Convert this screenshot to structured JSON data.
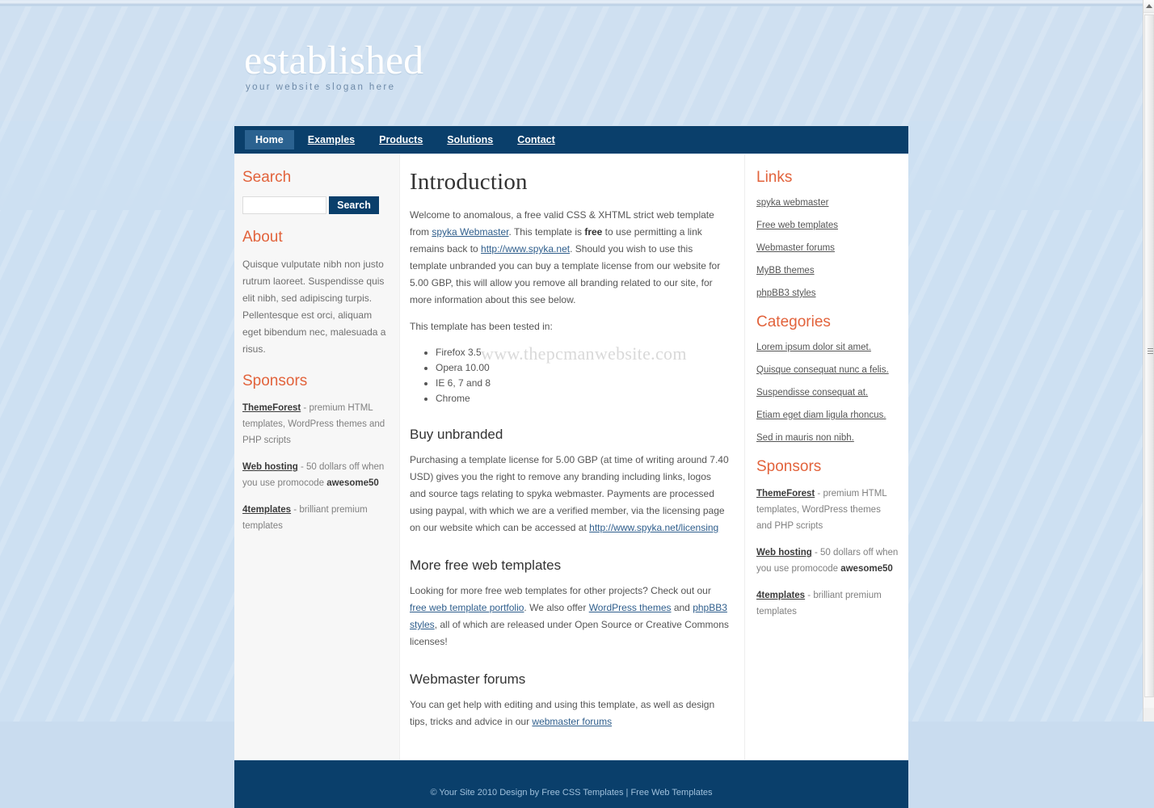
{
  "header": {
    "logo": "established",
    "slogan": "your website slogan here"
  },
  "nav": {
    "items": [
      {
        "label": "Home",
        "active": true
      },
      {
        "label": "Examples",
        "active": false
      },
      {
        "label": "Products",
        "active": false
      },
      {
        "label": "Solutions",
        "active": false
      },
      {
        "label": "Contact",
        "active": false
      }
    ]
  },
  "sidebar_left": {
    "search": {
      "heading": "Search",
      "value": "",
      "placeholder": "",
      "button_label": "Search"
    },
    "about": {
      "heading": "About",
      "text": "Quisque vulputate nibh non justo rutrum laoreet. Suspendisse quis elit nibh, sed adipiscing turpis. Pellentesque est orci, aliquam eget bibendum nec, malesuada a risus."
    },
    "sponsors": {
      "heading": "Sponsors",
      "items": [
        {
          "link": "ThemeForest",
          "text": " - premium HTML templates, WordPress themes and PHP scripts"
        },
        {
          "link": "Web hosting",
          "text": " - 50 dollars off when you use promocode ",
          "promo": "awesome50"
        },
        {
          "link": "4templates",
          "text": " - brilliant premium templates"
        }
      ]
    }
  },
  "main": {
    "title": "Introduction",
    "intro_1a": "Welcome to anomalous, a free valid CSS & XHTML strict web template from ",
    "intro_link_1": "spyka Webmaster",
    "intro_1b": ". This template is ",
    "intro_bold": "free",
    "intro_1c": " to use permitting a link remains back to ",
    "intro_link_2": "http://www.spyka.net",
    "intro_1d": ". Should you wish to use this template unbranded you can buy a template license from our website for 5.00 GBP, this will allow you remove all branding related to our site, for more information about this see below.",
    "tested_intro": "This template has been tested in:",
    "browsers": [
      "Firefox 3.5",
      "Opera 10.00",
      "IE 6, 7 and 8",
      "Chrome"
    ],
    "watermark": "www.thepcmanwebsite.com",
    "buy": {
      "heading": "Buy unbranded",
      "text_a": "Purchasing a template license for 5.00 GBP (at time of writing around 7.40 USD) gives you the right to remove any branding including links, logos and source tags relating to spyka webmaster. Payments are processed using paypal, with which we are a verified member, via the licensing page on our website which can be accessed at ",
      "link": "http://www.spyka.net/licensing"
    },
    "more_templates": {
      "heading": "More free web templates",
      "text_a": "Looking for more free web templates for other projects? Check out our ",
      "link_1": "free web template portfolio",
      "text_b": ". We also offer ",
      "link_2": "WordPress themes",
      "text_c": " and ",
      "link_3": "phpBB3 styles",
      "text_d": ", all of which are released under Open Source or Creative Commons licenses!"
    },
    "forums": {
      "heading": "Webmaster forums",
      "text_a": "You can get help with editing and using this template, as well as design tips, tricks and advice in our ",
      "link": "webmaster forums"
    }
  },
  "sidebar_right": {
    "links": {
      "heading": "Links",
      "items": [
        "spyka webmaster",
        "Free web templates",
        "Webmaster forums",
        "MyBB themes",
        "phpBB3 styles"
      ]
    },
    "categories": {
      "heading": "Categories",
      "items": [
        "Lorem ipsum dolor sit amet.",
        "Quisque consequat nunc a felis.",
        "Suspendisse consequat at.",
        "Etiam eget diam ligula rhoncus.",
        "Sed in mauris non nibh."
      ]
    },
    "sponsors": {
      "heading": "Sponsors",
      "items": [
        {
          "link": "ThemeForest",
          "text": " - premium HTML templates, WordPress themes and PHP scripts"
        },
        {
          "link": "Web hosting",
          "text": " - 50 dollars off when you use promocode ",
          "promo": "awesome50"
        },
        {
          "link": "4templates",
          "text": " - brilliant premium templates"
        }
      ]
    }
  },
  "footer": {
    "text": "© Your Site 2010 Design by Free CSS Templates | Free Web Templates"
  },
  "colors": {
    "navy": "#0a3f6b",
    "nav_active": "#2b6290",
    "accent_orange": "#e2633c",
    "page_bg": "#cde0f2",
    "link_blue": "#2f5e8c"
  }
}
